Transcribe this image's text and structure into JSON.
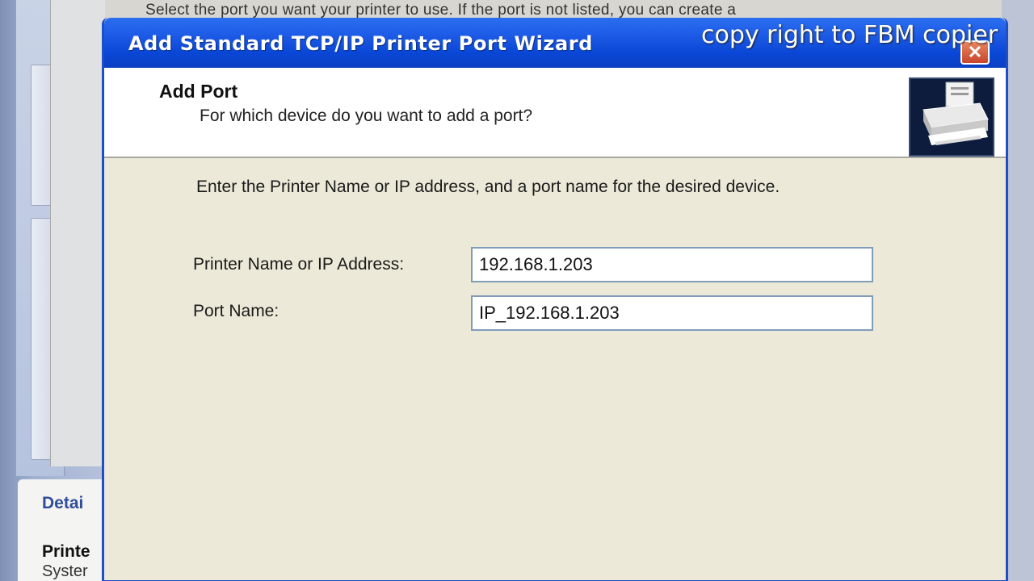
{
  "background": {
    "top_text": "Select the port you want your printer to use.  If the port is not listed, you can create a",
    "details_title": "Detai",
    "details_line1": "Printe",
    "details_line2": "Syster"
  },
  "dialog": {
    "title": "Add Standard TCP/IP Printer Port Wizard",
    "close_symbol": "✕",
    "header": {
      "title": "Add Port",
      "subtitle": "For which device do you want to add a port?"
    },
    "instruction": "Enter the Printer Name or IP address, and a port name for the desired device.",
    "fields": [
      {
        "label": "Printer Name or IP Address:",
        "value": "192.168.1.203"
      },
      {
        "label": "Port Name:",
        "value": "IP_192.168.1.203"
      }
    ]
  },
  "watermark": "copy right to FBM copier",
  "colors": {
    "titlebar": "#0a47d6",
    "dialog_body": "#ece9d8",
    "header_bg": "#ffffff",
    "close_button": "#c8472c"
  },
  "icons": {
    "header_icon": "printer-icon",
    "close": "close-icon"
  }
}
